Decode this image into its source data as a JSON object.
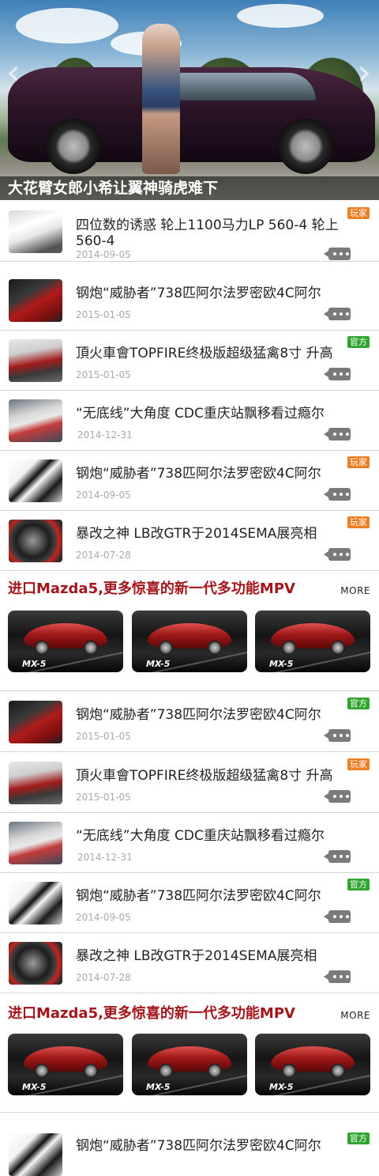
{
  "hero": {
    "caption": "大花臂女郎小希让翼神骑虎难下",
    "prev_icon": "chevron-left-icon",
    "next_icon": "chevron-right-icon"
  },
  "list1": [
    {
      "title": "四位数的诱惑 轮上1100马力LP 560-4  轮上560-4",
      "date": "2014-09-05",
      "badge": "玩家",
      "badge_color": "#ef7d22"
    },
    {
      "title": "钢炮“威胁者”738匹阿尔法罗密欧4C阿尔",
      "date": "2015-01-05",
      "badge": "",
      "badge_color": ""
    },
    {
      "title": "頂火車會TOPFIRE终极版超级猛禽8寸 升高",
      "date": "2015-01-05",
      "badge": "官方",
      "badge_color": "#2fa52f"
    },
    {
      "title": "“无底线”大角度 CDC重庆站飘移看过瘾尔",
      "date": "2014-12-31",
      "badge": "",
      "badge_color": ""
    },
    {
      "title": "钢炮“威胁者”738匹阿尔法罗密欧4C阿尔",
      "date": "2014-09-05",
      "badge": "玩家",
      "badge_color": "#ef7d22"
    },
    {
      "title": "暴改之神 LB改GTR于2014SEMA展亮相",
      "date": "2014-07-28",
      "badge": "玩家",
      "badge_color": "#ef7d22"
    }
  ],
  "section1": {
    "title": "进口Mazda5,更多惊喜的新一代多功能MPV",
    "more": "MORE",
    "cards": [
      {
        "model": "MX-5"
      },
      {
        "model": "MX-5"
      },
      {
        "model": "MX-5"
      }
    ]
  },
  "list2": [
    {
      "title": "钢炮“威胁者”738匹阿尔法罗密欧4C阿尔",
      "date": "2015-01-05",
      "badge": "官方",
      "badge_color": "#2fa52f"
    },
    {
      "title": "頂火車會TOPFIRE终极版超级猛禽8寸 升高",
      "date": "2015-01-05",
      "badge": "玩家",
      "badge_color": "#ef7d22"
    },
    {
      "title": "“无底线”大角度 CDC重庆站飘移看过瘾尔",
      "date": "2014-12-31",
      "badge": "",
      "badge_color": ""
    },
    {
      "title": "钢炮“威胁者”738匹阿尔法罗密欧4C阿尔",
      "date": "2014-09-05",
      "badge": "官方",
      "badge_color": "#2fa52f"
    },
    {
      "title": "暴改之神 LB改GTR于2014SEMA展亮相",
      "date": "2014-07-28",
      "badge": "",
      "badge_color": ""
    }
  ],
  "section2": {
    "title": "进口Mazda5,更多惊喜的新一代多功能MPV",
    "more": "MORE",
    "cards": [
      {
        "model": "MX-5"
      },
      {
        "model": "MX-5"
      },
      {
        "model": "MX-5"
      }
    ]
  },
  "list3": [
    {
      "title": "钢炮“威胁者”738匹阿尔法罗密欧4C阿尔",
      "badge": "官方",
      "badge_color": "#2fa52f"
    }
  ]
}
